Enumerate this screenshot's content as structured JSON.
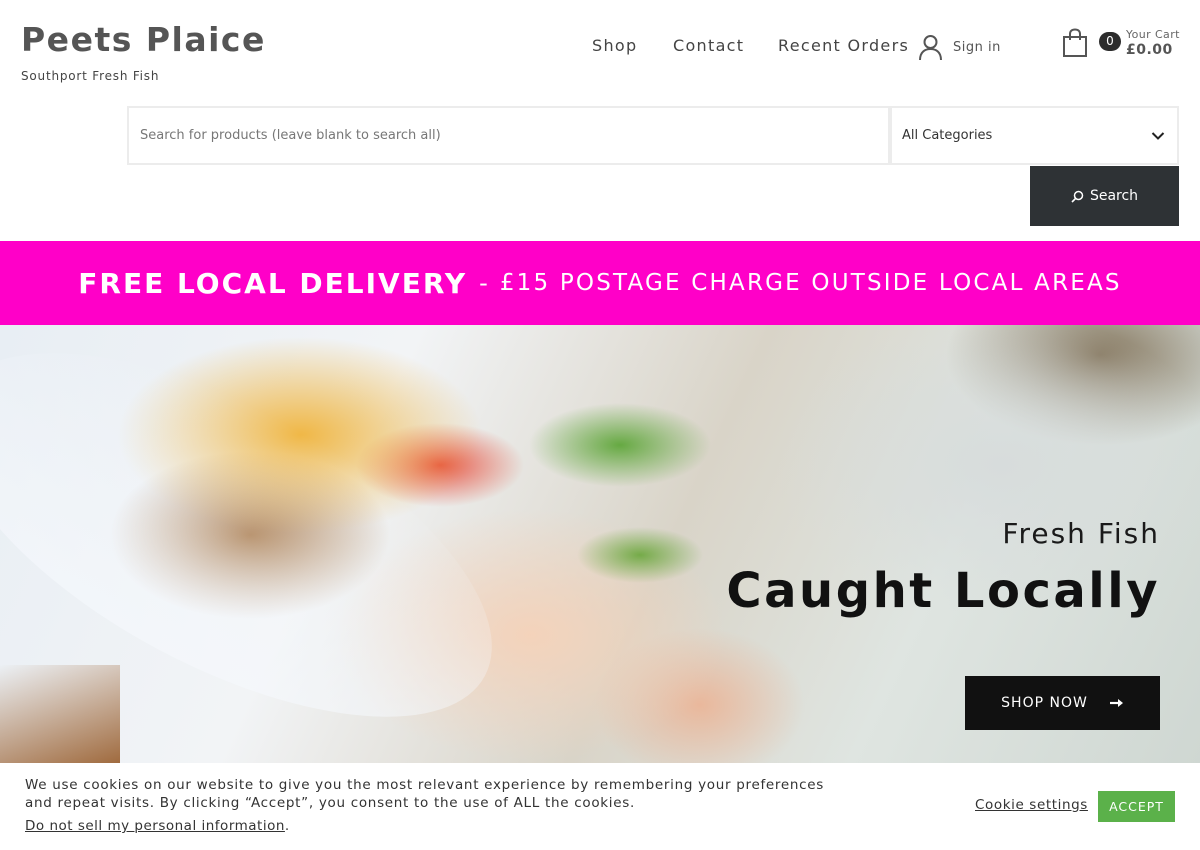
{
  "site": {
    "title": "Peets Plaice",
    "tagline": "Southport Fresh Fish"
  },
  "nav": {
    "items": [
      {
        "label": "Shop"
      },
      {
        "label": "Contact"
      },
      {
        "label": "Recent Orders"
      }
    ],
    "signin_label": "Sign in"
  },
  "cart": {
    "count": "0",
    "label": "Your Cart",
    "total": "£0.00"
  },
  "search": {
    "placeholder": "Search for products (leave blank to search all)",
    "category_selected": "All Categories",
    "button_label": "Search"
  },
  "banner": {
    "strong": "FREE LOCAL DELIVERY",
    "dash": "-",
    "rest": "£15 POSTAGE CHARGE OUTSIDE LOCAL AREAS",
    "color": "#ff00c8"
  },
  "hero": {
    "subtitle": "Fresh Fish",
    "title": "Caught Locally",
    "button_label": "SHOP NOW"
  },
  "cookie": {
    "text": "We use cookies on our website to give you the most relevant experience by remembering your preferences and repeat visits. By clicking “Accept”, you consent to the use of ALL the cookies.",
    "do_not_sell": "Do not sell my personal information",
    "settings_label": "Cookie settings",
    "accept_label": "ACCEPT",
    "accept_color": "#5bb14a"
  }
}
